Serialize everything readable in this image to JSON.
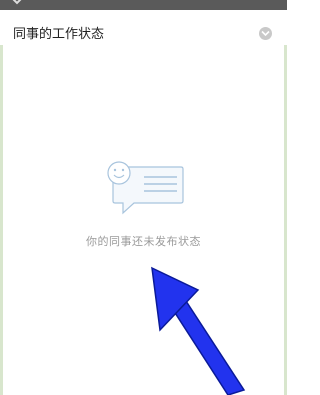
{
  "header": {
    "title": "同事的工作状态",
    "close_icon": "close-chevron-down-icon"
  },
  "empty_state": {
    "icon": "chat-bubble-smiley-icon",
    "message": "你的同事还未发布状态"
  },
  "annotation": {
    "icon": "blue-arrow-pointer-icon",
    "color": "#2233ee"
  },
  "colors": {
    "panel_background": "#ffffff",
    "title_text": "#222222",
    "empty_text": "#9a9a9a",
    "illustration_stroke": "#a8c4dd"
  }
}
